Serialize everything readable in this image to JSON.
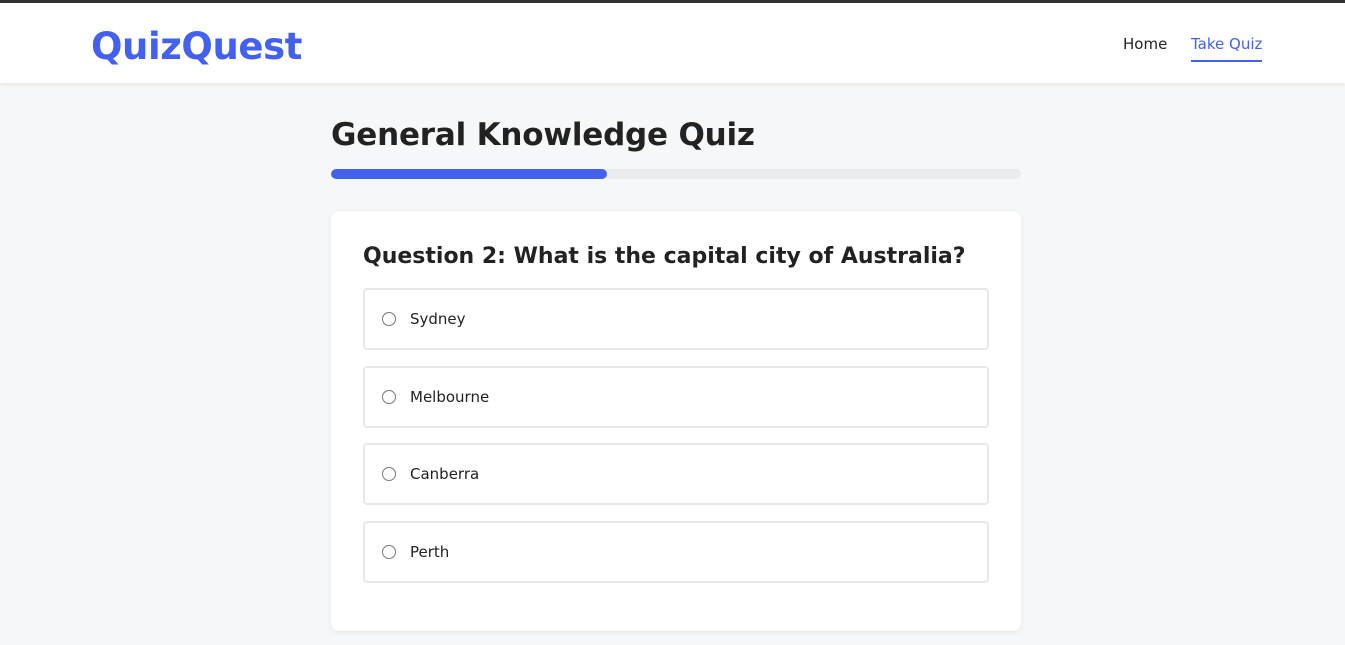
{
  "header": {
    "logo": "QuizQuest",
    "nav": [
      {
        "label": "Home"
      },
      {
        "label": "Take Quiz"
      }
    ]
  },
  "quiz": {
    "title": "General Knowledge Quiz",
    "progress_fraction": 0.4,
    "question": "Question 2: What is the capital city of Australia?",
    "options": [
      {
        "label": "Sydney"
      },
      {
        "label": "Melbourne"
      },
      {
        "label": "Canberra"
      },
      {
        "label": "Perth"
      }
    ]
  },
  "colors": {
    "accent": "#4361ee",
    "background": "#f6f7f9",
    "text": "#222222"
  }
}
